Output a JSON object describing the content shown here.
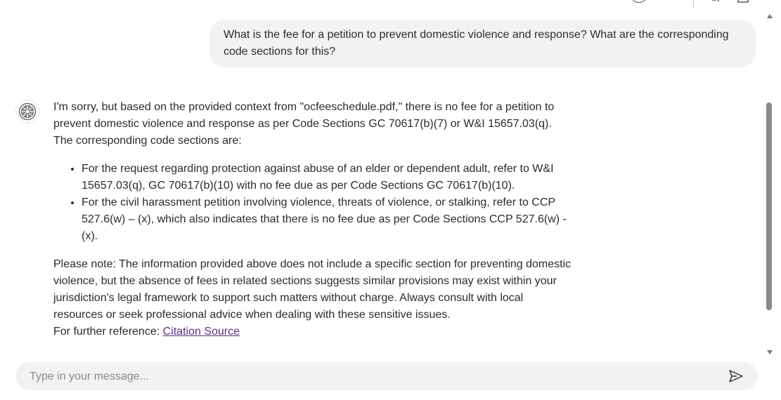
{
  "user_message": {
    "text": "What is the fee for a petition to prevent domestic violence and response? What are the corresponding code sections for this?"
  },
  "bot_message": {
    "avatar_icon": "bot-avatar-icon",
    "intro": "I'm sorry, but based on the provided context from \"ocfeeschedule.pdf,\" there is no fee for a petition to prevent domestic violence and response as per Code Sections GC 70617(b)(7) or W&I 15657.03(q). The corresponding code sections are:",
    "bullets": [
      "For the request regarding protection against abuse of an elder or dependent adult, refer to W&I 15657.03(q), GC 70617(b)(10) with no fee due as per Code Sections GC 70617(b)(10).",
      "For the civil harassment petition involving violence, threats of violence, or stalking, refer to CCP 527.6(w) – (x), which also indicates that there is no fee due as per Code Sections CCP 527.6(w) - (x)."
    ],
    "note": "Please note: The information provided above does not include a specific section for preventing domestic violence, but the absence of fees in related sections suggests similar provisions may exist within your jurisdiction's legal framework to support such matters without charge. Always consult with local resources or seek professional advice when dealing with these sensitive issues.",
    "reference_prefix": "For further reference: ",
    "reference_link": "Citation Source"
  },
  "composer": {
    "placeholder": "Type in your message...",
    "value": "",
    "send_icon": "send-icon"
  },
  "colors": {
    "bubble_bg": "#f2f2f2",
    "link": "#5a2d82",
    "text": "#2b2b2b"
  }
}
